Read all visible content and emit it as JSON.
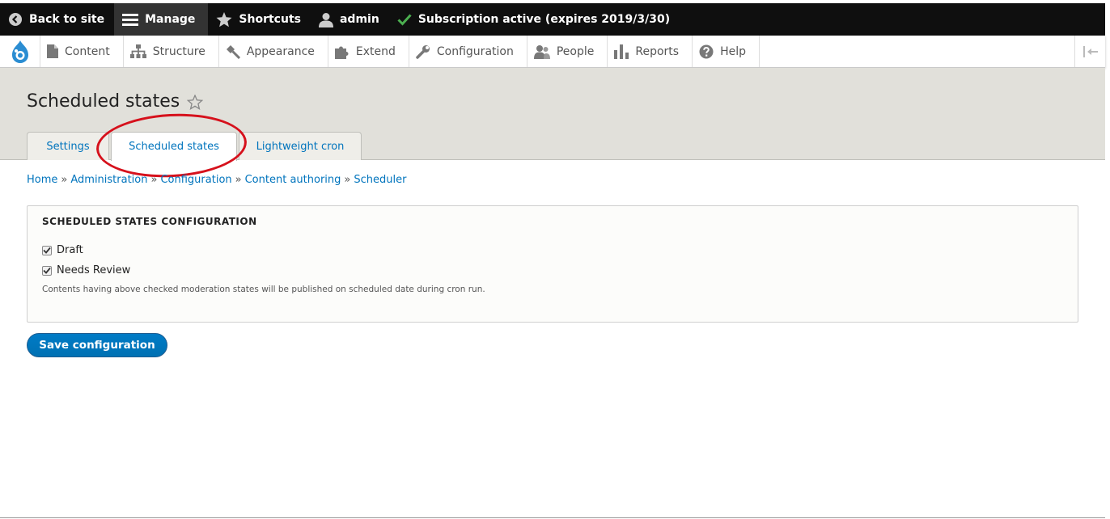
{
  "toolbar": {
    "back_label": "Back to site",
    "manage_label": "Manage",
    "shortcuts_label": "Shortcuts",
    "user_label": "admin",
    "subscription_label": "Subscription active (expires 2019/3/30)"
  },
  "menu": {
    "items": [
      {
        "label": "Content",
        "icon": "file-icon"
      },
      {
        "label": "Structure",
        "icon": "sitemap-icon"
      },
      {
        "label": "Appearance",
        "icon": "brush-icon"
      },
      {
        "label": "Extend",
        "icon": "puzzle-icon"
      },
      {
        "label": "Configuration",
        "icon": "wrench-icon"
      },
      {
        "label": "People",
        "icon": "people-icon"
      },
      {
        "label": "Reports",
        "icon": "bar-chart-icon"
      },
      {
        "label": "Help",
        "icon": "help-icon"
      }
    ]
  },
  "page": {
    "title": "Scheduled states"
  },
  "tabs": [
    {
      "label": "Settings",
      "active": false
    },
    {
      "label": "Scheduled states",
      "active": true
    },
    {
      "label": "Lightweight cron",
      "active": false
    }
  ],
  "breadcrumb": [
    "Home",
    "Administration",
    "Configuration",
    "Content authoring",
    "Scheduler"
  ],
  "breadcrumb_separator": "»",
  "form": {
    "legend": "SCHEDULED STATES CONFIGURATION",
    "options": [
      {
        "label": "Draft",
        "checked": true
      },
      {
        "label": "Needs Review",
        "checked": true
      }
    ],
    "description": "Contents having above checked moderation states will be published on scheduled date during cron run.",
    "submit_label": "Save configuration"
  },
  "colors": {
    "link": "#0074bd",
    "toolbar_bg": "#0f0f0f",
    "header_band": "#e1e0da",
    "primary_button": "#0071b8",
    "annotation": "#d6111c",
    "check": "#4caf50"
  }
}
